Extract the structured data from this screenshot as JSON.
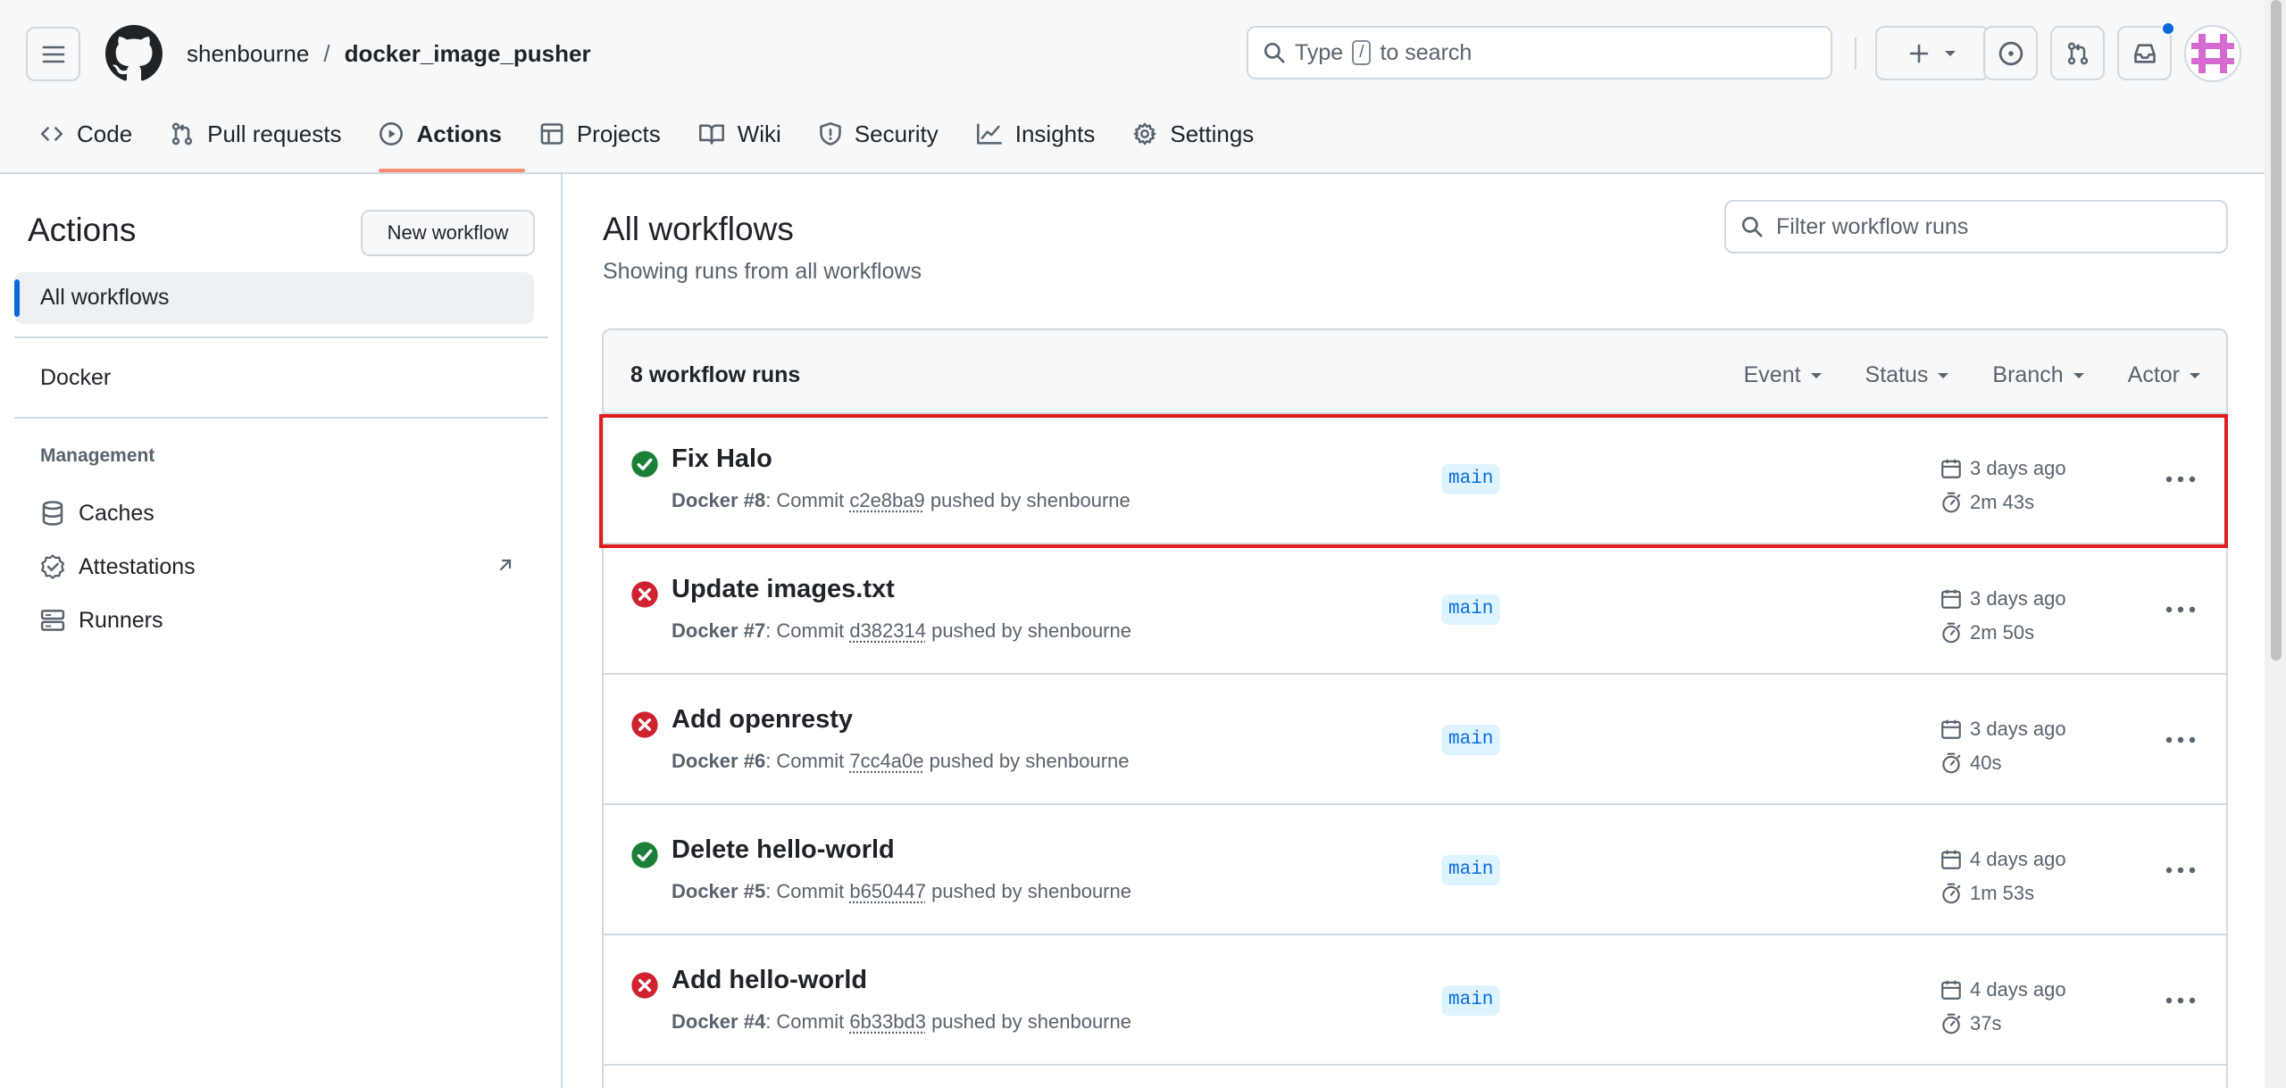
{
  "header": {
    "owner": "shenbourne",
    "separator": "/",
    "repo": "docker_image_pusher",
    "search_prefix": "Type",
    "search_key": "/",
    "search_suffix": "to search"
  },
  "nav": {
    "tabs": [
      {
        "label": "Code",
        "icon": "code-icon"
      },
      {
        "label": "Pull requests",
        "icon": "git-pull-request-icon"
      },
      {
        "label": "Actions",
        "icon": "play-icon",
        "active": true
      },
      {
        "label": "Projects",
        "icon": "table-icon"
      },
      {
        "label": "Wiki",
        "icon": "book-icon"
      },
      {
        "label": "Security",
        "icon": "shield-icon"
      },
      {
        "label": "Insights",
        "icon": "graph-icon"
      },
      {
        "label": "Settings",
        "icon": "gear-icon"
      }
    ]
  },
  "sidebar": {
    "title": "Actions",
    "new_workflow": "New workflow",
    "all_workflows": "All workflows",
    "workflow_item": "Docker",
    "management_heading": "Management",
    "management_items": [
      {
        "label": "Caches",
        "icon": "database-icon"
      },
      {
        "label": "Attestations",
        "icon": "verified-icon"
      },
      {
        "label": "Runners",
        "icon": "server-icon"
      }
    ]
  },
  "main": {
    "title": "All workflows",
    "subtitle": "Showing runs from all workflows",
    "filter_placeholder": "Filter workflow runs",
    "runs_count": "8 workflow runs",
    "filters": [
      "Event",
      "Status",
      "Branch",
      "Actor"
    ],
    "runs": [
      {
        "status": "success",
        "title": "Fix Halo",
        "workflow": "Docker #8",
        "sha": "c2e8ba9",
        "author": "shenbourne",
        "branch": "main",
        "ago": "3 days ago",
        "duration": "2m 43s"
      },
      {
        "status": "failure",
        "title": "Update images.txt",
        "workflow": "Docker #7",
        "sha": "d382314",
        "author": "shenbourne",
        "branch": "main",
        "ago": "3 days ago",
        "duration": "2m 50s"
      },
      {
        "status": "failure",
        "title": "Add openresty",
        "workflow": "Docker #6",
        "sha": "7cc4a0e",
        "author": "shenbourne",
        "branch": "main",
        "ago": "3 days ago",
        "duration": "40s"
      },
      {
        "status": "success",
        "title": "Delete hello-world",
        "workflow": "Docker #5",
        "sha": "b650447",
        "author": "shenbourne",
        "branch": "main",
        "ago": "4 days ago",
        "duration": "1m 53s"
      },
      {
        "status": "failure",
        "title": "Add hello-world",
        "workflow": "Docker #4",
        "sha": "6b33bd3",
        "author": "shenbourne",
        "branch": "main",
        "ago": "4 days ago",
        "duration": "37s"
      }
    ],
    "commit_word": "Commit",
    "pushed_by": "pushed by"
  },
  "colors": {
    "success": "#1a7f37",
    "failure": "#cf222e",
    "accent": "#0969da",
    "tab_underline": "#fd8c73",
    "highlight": "#e11d1d"
  }
}
